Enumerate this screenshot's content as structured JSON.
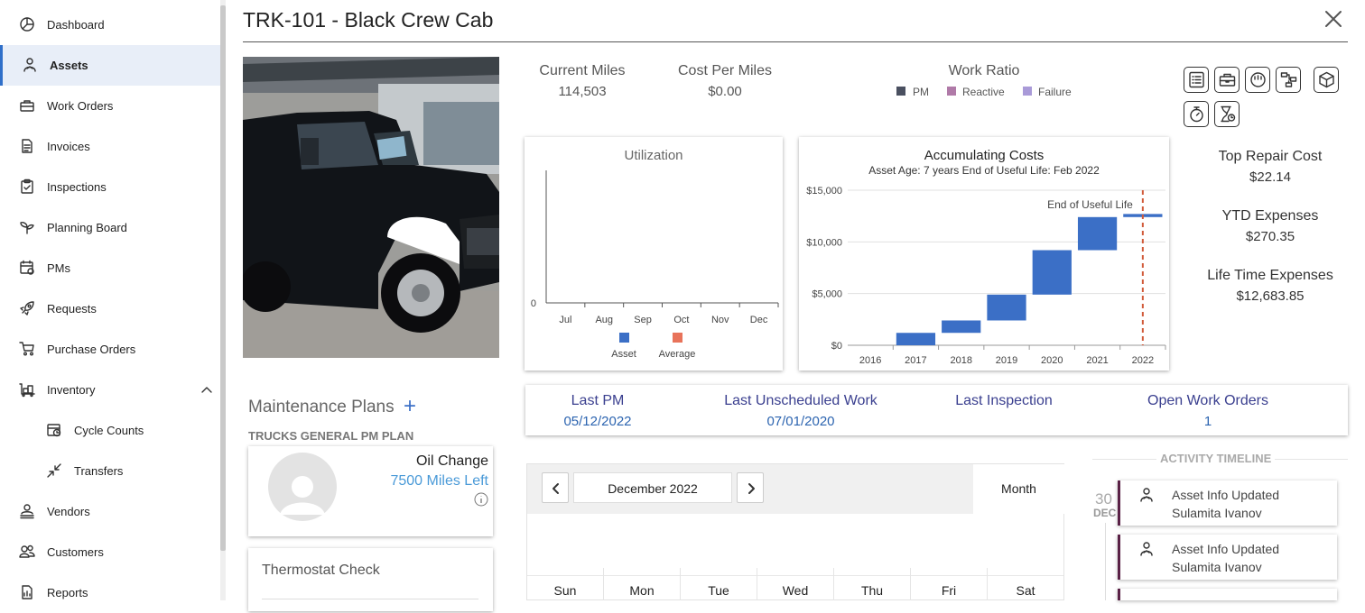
{
  "sidebar": {
    "items": [
      {
        "label": "Dashboard",
        "icon": "dashboard-icon"
      },
      {
        "label": "Assets",
        "icon": "assets-icon"
      },
      {
        "label": "Work Orders",
        "icon": "toolbox-icon"
      },
      {
        "label": "Invoices",
        "icon": "invoice-icon"
      },
      {
        "label": "Inspections",
        "icon": "clipboard-icon"
      },
      {
        "label": "Planning Board",
        "icon": "sprout-icon"
      },
      {
        "label": "PMs",
        "icon": "calendar-icon"
      },
      {
        "label": "Requests",
        "icon": "rocket-icon"
      },
      {
        "label": "Purchase Orders",
        "icon": "cart-icon"
      },
      {
        "label": "Inventory",
        "icon": "inventory-icon"
      },
      {
        "label": "Cycle Counts",
        "icon": "cycle-count-icon"
      },
      {
        "label": "Transfers",
        "icon": "transfer-icon"
      },
      {
        "label": "Vendors",
        "icon": "vendor-icon"
      },
      {
        "label": "Customers",
        "icon": "customers-icon"
      },
      {
        "label": "Reports",
        "icon": "reports-icon"
      }
    ]
  },
  "header": {
    "title": "TRK-101 - Black Crew Cab"
  },
  "stats": {
    "current_miles_label": "Current Miles",
    "current_miles_value": "114,503",
    "cost_per_miles_label": "Cost Per Miles",
    "cost_per_miles_value": "$0.00",
    "work_ratio_label": "Work Ratio",
    "work_ratio_legend": [
      {
        "label": "PM",
        "color": "#4a5060"
      },
      {
        "label": "Reactive",
        "color": "#b07aa8"
      },
      {
        "label": "Failure",
        "color": "#a99ad8"
      }
    ]
  },
  "right_stats": {
    "top_repair_label": "Top Repair Cost",
    "top_repair_value": "$22.14",
    "ytd_label": "YTD Expenses",
    "ytd_value": "$270.35",
    "lifetime_label": "Life Time Expenses",
    "lifetime_value": "$12,683.85"
  },
  "chart_data": [
    {
      "type": "bar",
      "title": "Utilization",
      "categories": [
        "Jul",
        "Aug",
        "Sep",
        "Oct",
        "Nov",
        "Dec"
      ],
      "series": [
        {
          "name": "Asset",
          "values": [
            0,
            0,
            0,
            0,
            0,
            0
          ],
          "color": "#3b6fc6"
        },
        {
          "name": "Average",
          "values": [
            0,
            0,
            0,
            0,
            0,
            0
          ],
          "color": "#e8735a"
        }
      ],
      "yticks": [
        "0"
      ]
    },
    {
      "type": "bar",
      "title": "Accumulating Costs",
      "subtitle": "Asset Age: 7 years   End of Useful Life: Feb 2022",
      "categories": [
        "2016",
        "2017",
        "2018",
        "2019",
        "2020",
        "2021",
        "2022"
      ],
      "series": [
        {
          "name": "Accumulating Costs",
          "ranges": [
            [
              0,
              0
            ],
            [
              0,
              1200
            ],
            [
              1200,
              2400
            ],
            [
              2400,
              4900
            ],
            [
              4900,
              9200
            ],
            [
              9200,
              12400
            ],
            [
              12400,
              12700
            ]
          ],
          "color": "#3b6fc6"
        }
      ],
      "ylim": [
        0,
        15000
      ],
      "yticks": [
        "$0",
        "$5,000",
        "$10,000",
        "$15,000"
      ],
      "annotation": "End of Useful Life",
      "annotation_color": "#d15a3a",
      "annotation_x": "2022"
    }
  ],
  "kpis": [
    {
      "label": "Last PM",
      "value": "05/12/2022"
    },
    {
      "label": "Last Unscheduled Work",
      "value": "07/01/2020"
    },
    {
      "label": "Last Inspection",
      "value": ""
    },
    {
      "label": "Open Work Orders",
      "value": "1"
    }
  ],
  "maintenance": {
    "title": "Maintenance Plans",
    "add": "+",
    "plan_name": "TRUCKS GENERAL PM PLAN",
    "cards": [
      {
        "title": "Oil Change",
        "subtitle": "7500 Miles Left"
      },
      {
        "title": "Thermostat Check",
        "subtitle": ""
      }
    ]
  },
  "calendar": {
    "month_label": "December 2022",
    "view_label": "Month",
    "days": [
      "Sun",
      "Mon",
      "Tue",
      "Wed",
      "Thu",
      "Fri",
      "Sat"
    ]
  },
  "timeline": {
    "title": "ACTIVITY TIMELINE",
    "date_day": "30",
    "date_month": "DEC",
    "entries": [
      {
        "title": "Asset Info Updated",
        "user": "Sulamita Ivanov"
      },
      {
        "title": "Asset Info Updated",
        "user": "Sulamita Ivanov"
      }
    ]
  }
}
